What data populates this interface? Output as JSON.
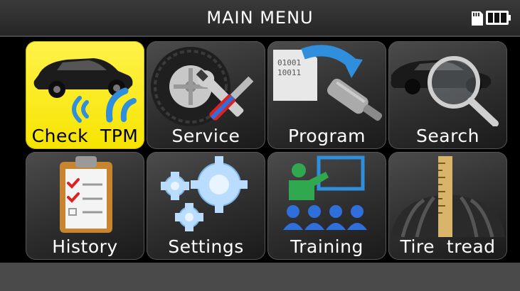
{
  "header": {
    "title": "MAIN MENU"
  },
  "status": {
    "battery_icon": "battery-icon",
    "device_icon": "sd-card-icon"
  },
  "menu": {
    "items": [
      {
        "label": "Check  TPM",
        "icon": "car-signal-icon",
        "selected": true
      },
      {
        "label": "Service",
        "icon": "tire-tools-icon",
        "selected": false
      },
      {
        "label": "Program",
        "icon": "program-sensor-icon",
        "selected": false
      },
      {
        "label": "Search",
        "icon": "car-search-icon",
        "selected": false
      },
      {
        "label": "History",
        "icon": "clipboard-checklist-icon",
        "selected": false
      },
      {
        "label": "Settings",
        "icon": "gears-icon",
        "selected": false
      },
      {
        "label": "Training",
        "icon": "classroom-icon",
        "selected": false
      },
      {
        "label": "Tire  tread",
        "icon": "tire-tread-gauge-icon",
        "selected": false
      }
    ]
  },
  "colors": {
    "selected_tile": "#f6e400",
    "tile_bg": "#3a3a3a",
    "title_bar": "#2e2e2e",
    "bottom_bar": "#4a4a4a",
    "battery_green": "#2ecc40",
    "accent_blue": "#2f8fdc"
  }
}
